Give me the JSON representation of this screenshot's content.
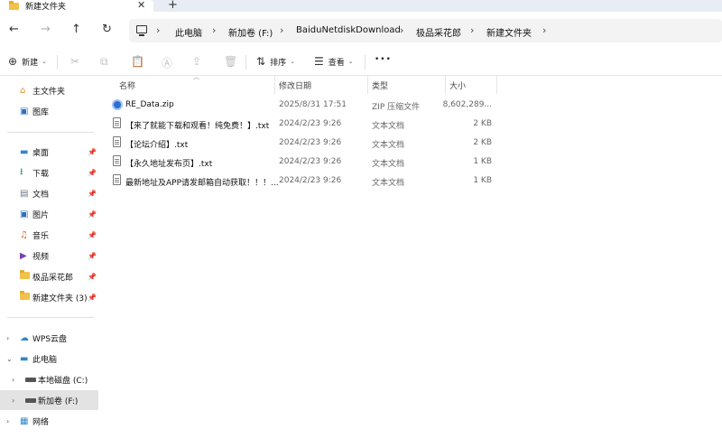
{
  "tab": {
    "title": "新建文件夹",
    "close": "✕",
    "new": "+"
  },
  "nav": {
    "back": "←",
    "forward": "→",
    "up": "↑",
    "refresh": "↻"
  },
  "breadcrumb": [
    "此电脑",
    "新加卷 (F:)",
    "BaiduNetdiskDownload",
    "极品采花郎",
    "新建文件夹"
  ],
  "toolbar": {
    "new_label": "新建",
    "sort_label": "排序",
    "view_label": "查看",
    "more": "•••"
  },
  "sidebar": {
    "top": [
      {
        "label": "主文件夹",
        "icon": "home-icon"
      },
      {
        "label": "图库",
        "icon": "gallery-icon"
      }
    ],
    "quick": [
      {
        "label": "桌面",
        "icon": "desktop-icon"
      },
      {
        "label": "下载",
        "icon": "download-icon"
      },
      {
        "label": "文档",
        "icon": "document-icon"
      },
      {
        "label": "图片",
        "icon": "pictures-icon"
      },
      {
        "label": "音乐",
        "icon": "music-icon"
      },
      {
        "label": "视频",
        "icon": "video-icon"
      },
      {
        "label": "极品采花郎",
        "icon": "folder-icon"
      },
      {
        "label": "新建文件夹 (3)",
        "icon": "folder-icon"
      }
    ],
    "tree": [
      {
        "label": "WPS云盘",
        "icon": "cloud-icon"
      },
      {
        "label": "此电脑",
        "icon": "pc-icon"
      },
      {
        "label": "本地磁盘 (C:)",
        "icon": "drive-icon"
      },
      {
        "label": "新加卷 (F:)",
        "icon": "drive-icon"
      },
      {
        "label": "网络",
        "icon": "network-icon"
      }
    ]
  },
  "columns": {
    "name": "名称",
    "date": "修改日期",
    "type": "类型",
    "size": "大小"
  },
  "files": [
    {
      "name": "RE_Data.zip",
      "date": "2025/8/31 17:51",
      "type": "ZIP 压缩文件",
      "size": "8,602,289...",
      "icon": "zip-icon"
    },
    {
      "name": "【来了就能下载和观看！纯免费！】.txt",
      "date": "2024/2/23 9:26",
      "type": "文本文档",
      "size": "2 KB",
      "icon": "txt-icon"
    },
    {
      "name": "【论坛介绍】.txt",
      "date": "2024/2/23 9:26",
      "type": "文本文档",
      "size": "2 KB",
      "icon": "txt-icon"
    },
    {
      "name": "【永久地址发布页】.txt",
      "date": "2024/2/23 9:26",
      "type": "文本文档",
      "size": "1 KB",
      "icon": "txt-icon"
    },
    {
      "name": "最新地址及APP请发邮箱自动获取！！！...",
      "date": "2024/2/23 9:26",
      "type": "文本文档",
      "size": "1 KB",
      "icon": "txt-icon"
    }
  ]
}
